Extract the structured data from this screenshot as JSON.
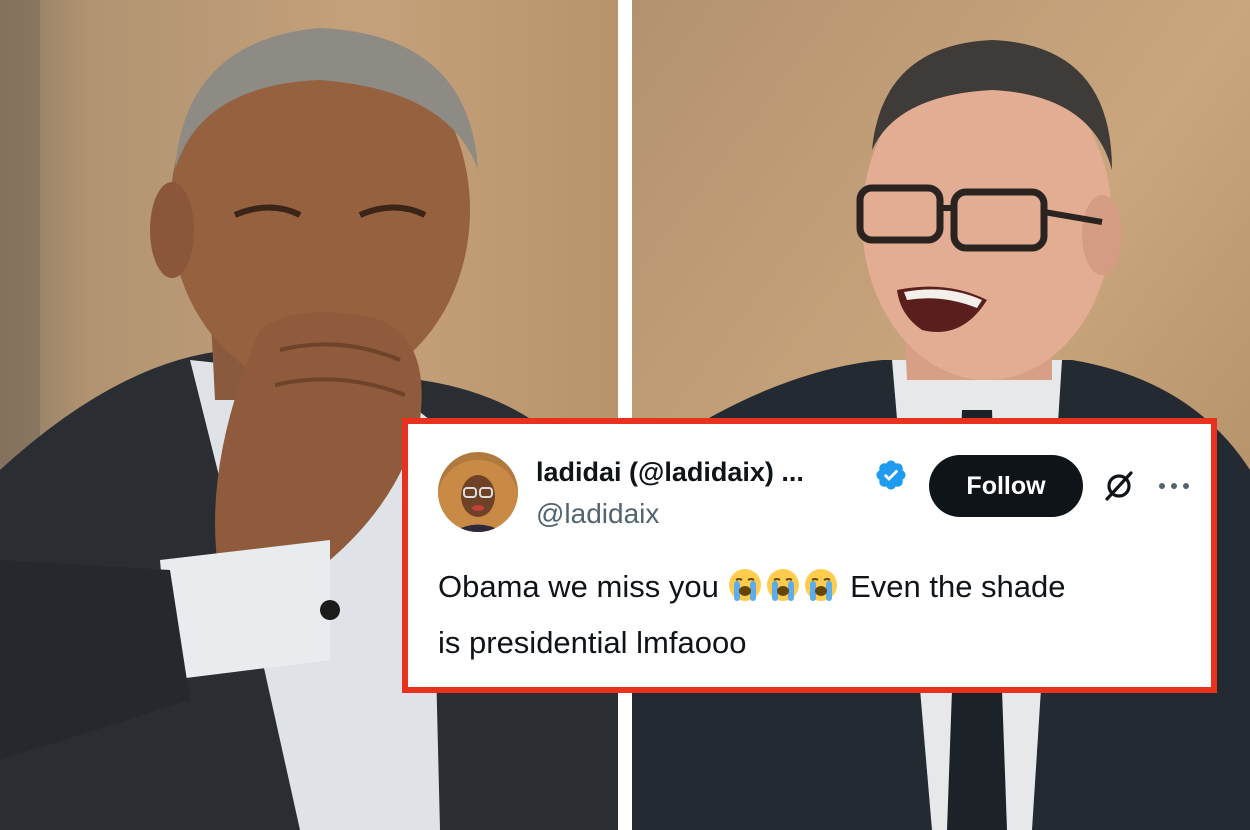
{
  "tweet": {
    "display_name": "ladidai (@ladidaix) ...",
    "handle": "@ladidaix",
    "follow_label": "Follow",
    "text_part1": "Obama we miss you",
    "text_part2": "Even the shade",
    "text_part3": "is presidential lmfaooo",
    "emojis": [
      "loudly-crying-face-icon",
      "loudly-crying-face-icon",
      "loudly-crying-face-icon"
    ]
  },
  "colors": {
    "frame_border": "#e8321e",
    "follow_button_bg": "#0f1419",
    "verified_badge": "#1d9bf0",
    "handle_text": "#536471"
  },
  "icons": {
    "verified": "verified-badge-icon",
    "x_logo": "x-logo-icon",
    "more": "more-options-icon"
  }
}
